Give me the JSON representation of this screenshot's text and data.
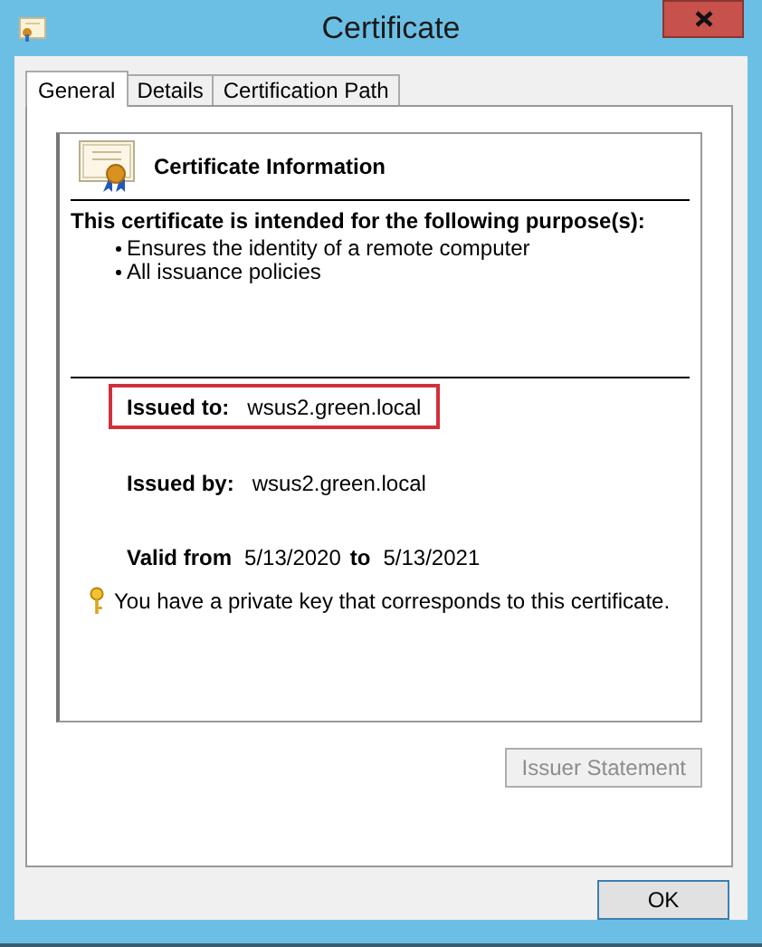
{
  "window": {
    "title": "Certificate"
  },
  "tabs": [
    {
      "label": "General",
      "selected": true
    },
    {
      "label": "Details",
      "selected": false
    },
    {
      "label": "Certification Path",
      "selected": false
    }
  ],
  "info": {
    "heading": "Certificate Information",
    "purpose_heading": "This certificate is intended for the following purpose(s):",
    "purposes": [
      "Ensures the identity of a remote computer",
      "All issuance policies"
    ],
    "issued_to": {
      "label": "Issued to:",
      "value": "wsus2.green.local",
      "highlighted": true
    },
    "issued_by": {
      "label": "Issued by:",
      "value": "wsus2.green.local"
    },
    "validity": {
      "from_label": "Valid from",
      "from": "5/13/2020",
      "to_label": "to",
      "to": "5/13/2021"
    },
    "private_key_note": "You have a private key that corresponds to this certificate."
  },
  "issuer_statement_button": {
    "label": "Issuer Statement",
    "disabled": true
  },
  "ok_button": {
    "label": "OK",
    "disabled": false
  }
}
